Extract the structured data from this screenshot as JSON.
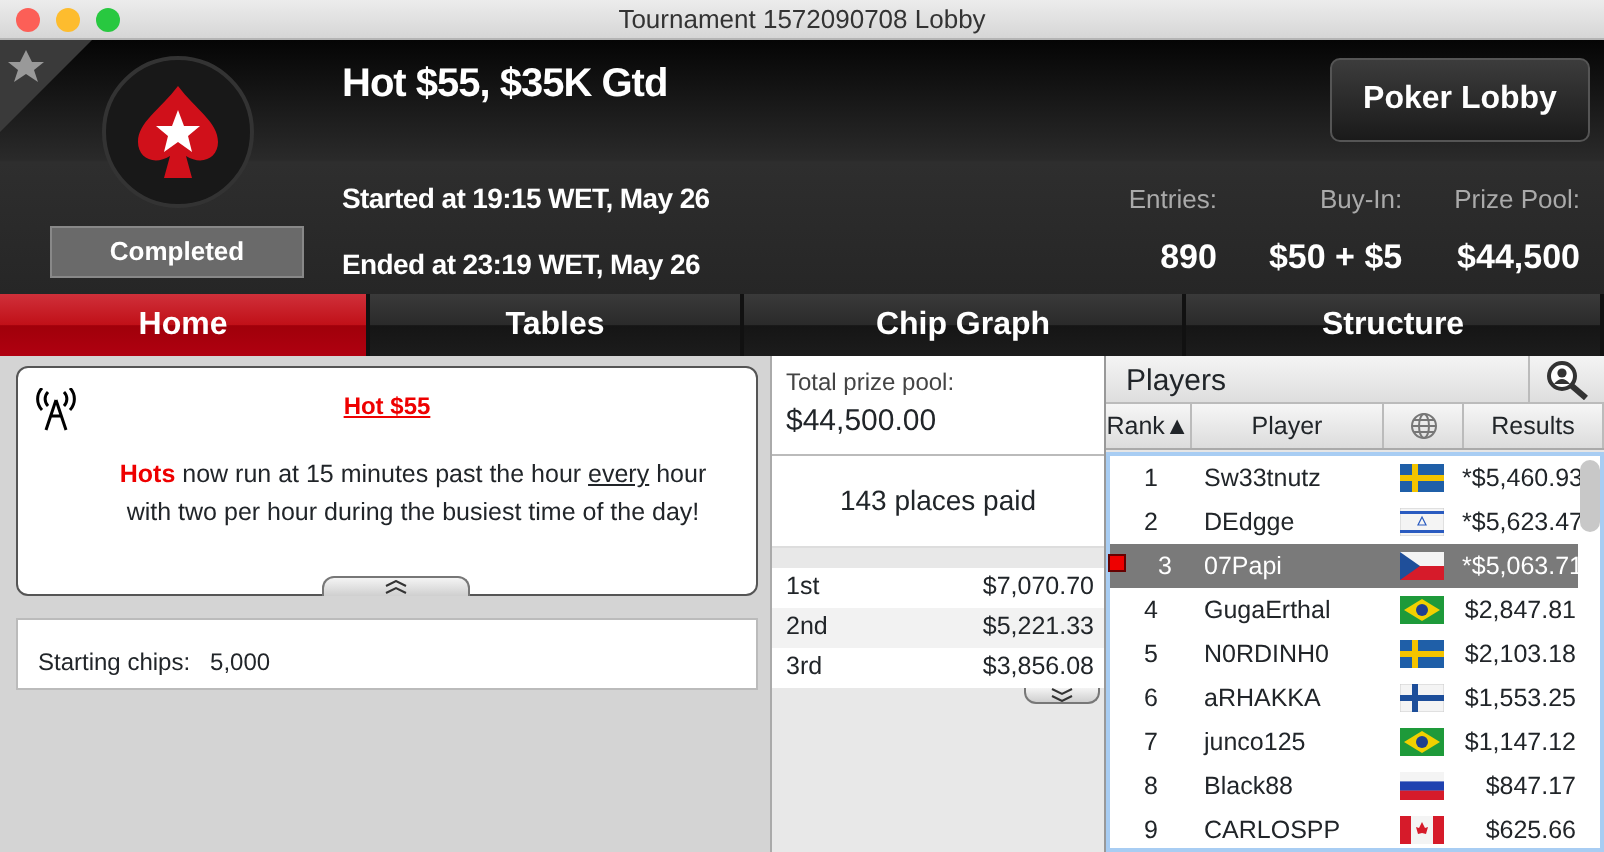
{
  "window": {
    "title": "Tournament 1572090708 Lobby"
  },
  "header": {
    "title": "Hot $55, $35K Gtd",
    "status": "Completed",
    "started": "Started at 19:15 WET, May 26",
    "ended": "Ended at 23:19 WET, May 26",
    "lobby_button": "Poker Lobby",
    "stats": [
      {
        "label": "Entries:",
        "value": "890"
      },
      {
        "label": "Buy-In:",
        "value": "$50 + $5"
      },
      {
        "label": "Prize Pool:",
        "value": "$44,500"
      }
    ]
  },
  "tabs": [
    {
      "label": "Home",
      "selected": true
    },
    {
      "label": "Tables",
      "selected": false
    },
    {
      "label": "Chip Graph",
      "selected": false
    },
    {
      "label": "Structure",
      "selected": false
    }
  ],
  "notice": {
    "title": "Hot $55",
    "text": "**Hots** now run at 15 minutes past the hour *every* hour with two per hour during the busiest time of the day!"
  },
  "info": [
    {
      "label": "Starting chips:",
      "value": "5,000"
    }
  ],
  "prizes": {
    "total_label": "Total prize pool:",
    "total": "$44,500.00",
    "places": "143 places paid",
    "rows": [
      {
        "place": "1st",
        "amount": "$7,070.70"
      },
      {
        "place": "2nd",
        "amount": "$5,221.33"
      },
      {
        "place": "3rd",
        "amount": "$3,856.08"
      }
    ]
  },
  "players": {
    "title": "Players",
    "columns": [
      "Rank▲",
      "Player",
      "Results"
    ],
    "rows": [
      {
        "rank": "1",
        "name": "Sw33tnutz",
        "kind": "se",
        "result": "*$5,460.93",
        "selected": false
      },
      {
        "rank": "2",
        "name": "DEdgge",
        "kind": "il",
        "result": "*$5,623.47",
        "selected": false
      },
      {
        "rank": "3",
        "name": "07Papi",
        "kind": "cz",
        "result": "*$5,063.71",
        "selected": true
      },
      {
        "rank": "4",
        "name": "GugaErthal",
        "kind": "br",
        "result": "$2,847.81",
        "selected": false
      },
      {
        "rank": "5",
        "name": "N0RDINH0",
        "kind": "se",
        "result": "$2,103.18",
        "selected": false
      },
      {
        "rank": "6",
        "name": "aRHAKKA",
        "kind": "fi",
        "result": "$1,553.25",
        "selected": false
      },
      {
        "rank": "7",
        "name": "junco125",
        "kind": "br",
        "result": "$1,147.12",
        "selected": false
      },
      {
        "rank": "8",
        "name": "Black88",
        "kind": "ru",
        "result": "$847.17",
        "selected": false
      },
      {
        "rank": "9",
        "name": "CARLOSPP",
        "kind": "ca",
        "result": "$625.66",
        "selected": false
      }
    ]
  }
}
